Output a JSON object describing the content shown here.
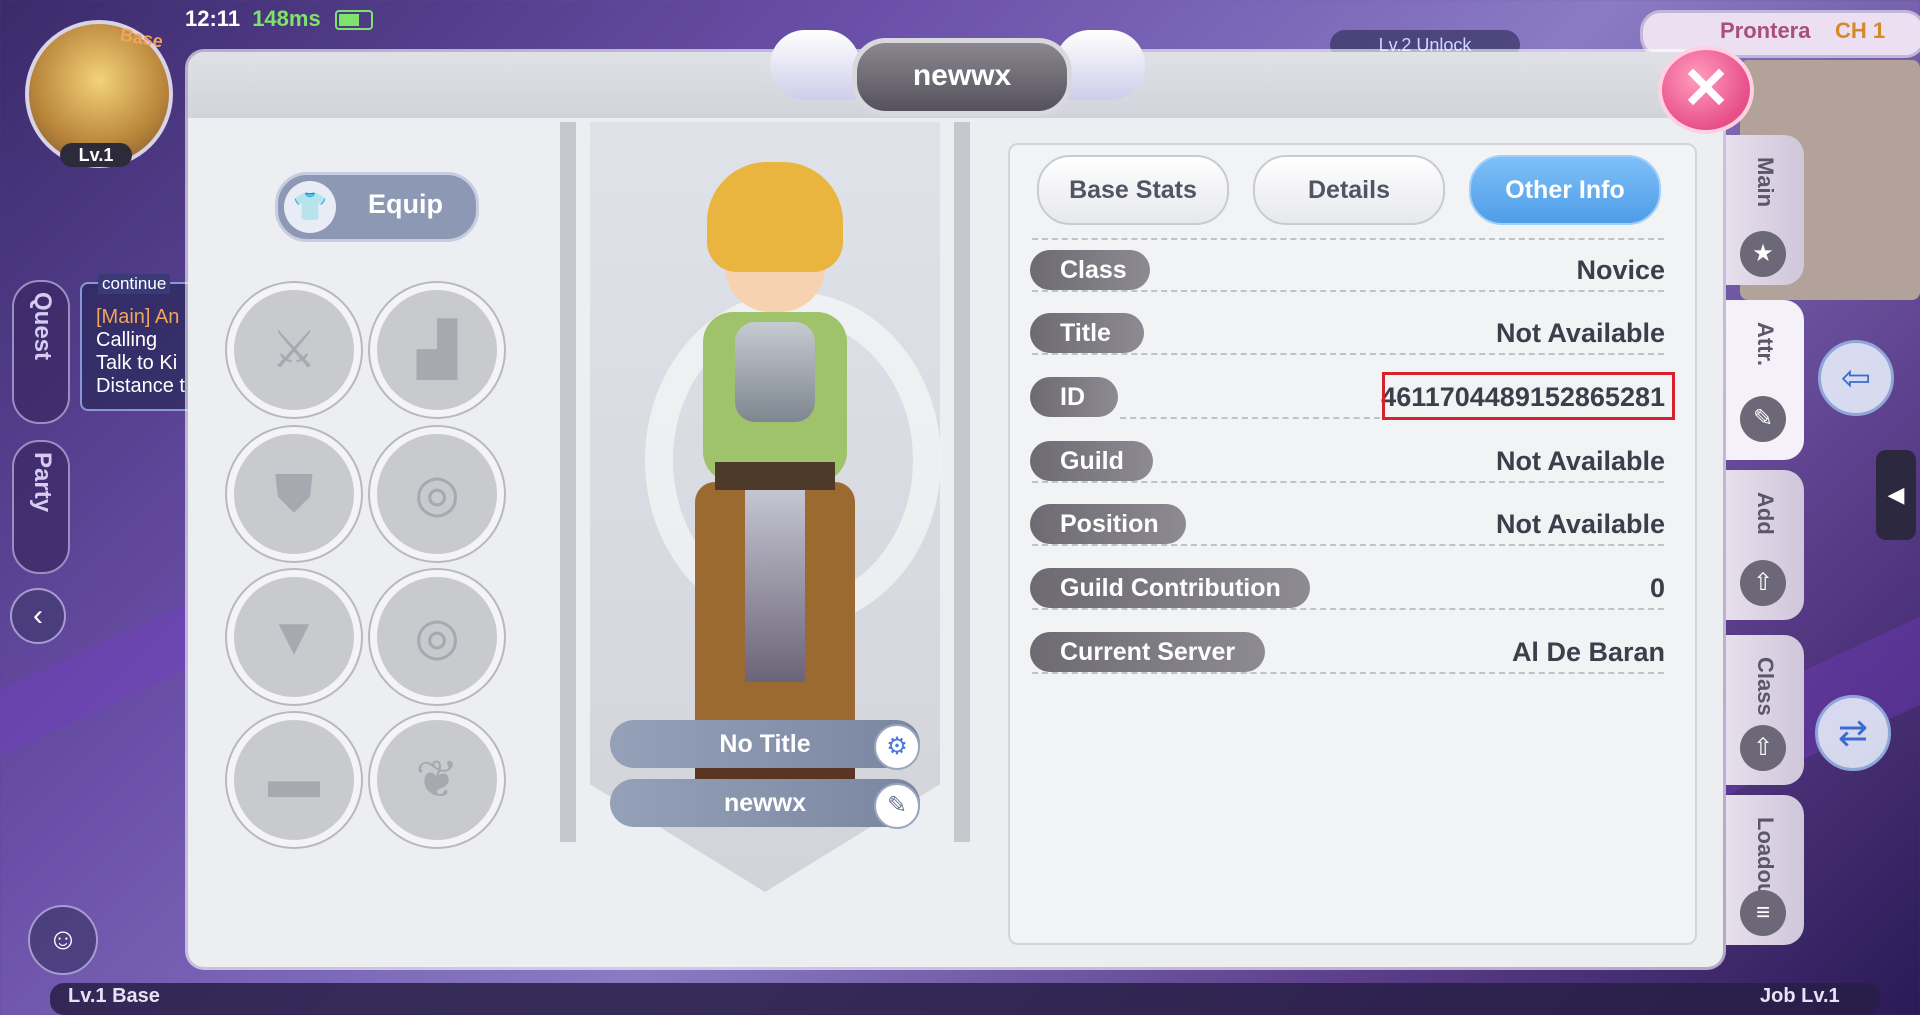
{
  "hud": {
    "time": "12:11",
    "ping": "148ms",
    "avatar_level": "Lv.1",
    "base_tag": "Base",
    "unlock_text": "Lv.2 Unlock",
    "map_town": "Prontera",
    "map_channel": "CH 1"
  },
  "left_hud": {
    "quest_label": "Quest",
    "party_label": "Party",
    "quest_continue": "continue",
    "quest_lines": [
      "[Main] An",
      "Calling",
      "Talk to Ki",
      "Distance t"
    ],
    "back_arrow": "‹"
  },
  "bottom_bar": {
    "base_level": "Lv.1  Base",
    "job_level": "Job  Lv.1"
  },
  "dialog": {
    "player_name": "newwx",
    "close_icon": "✕"
  },
  "equip": {
    "toggle_label": "Equip",
    "slots": [
      "sword-icon",
      "boots-icon",
      "shield-icon",
      "accessory-icon",
      "armor-icon",
      "accessory-icon",
      "cape-icon",
      "pet-icon"
    ]
  },
  "character": {
    "title_plate": "No Title",
    "name_plate": "newwx"
  },
  "tabs": {
    "base_stats": "Base Stats",
    "details": "Details",
    "other_info": "Other Info",
    "active": "other_info"
  },
  "info_rows": [
    {
      "label": "Class",
      "value": "Novice"
    },
    {
      "label": "Title",
      "value": "Not Available"
    },
    {
      "label": "ID",
      "value": "4611704489152865281"
    },
    {
      "label": "Guild",
      "value": "Not Available"
    },
    {
      "label": "Position",
      "value": "Not Available"
    },
    {
      "label": "Guild Contribution",
      "value": "0"
    },
    {
      "label": "Current Server",
      "value": "Al De Baran"
    }
  ],
  "right_tabs": [
    "Main",
    "Attr.",
    "Add",
    "Class",
    "Loadout"
  ],
  "colors": {
    "active_tab": "#4f9de8",
    "highlight_box": "#d4232c",
    "close_button": "#e84f8a"
  }
}
